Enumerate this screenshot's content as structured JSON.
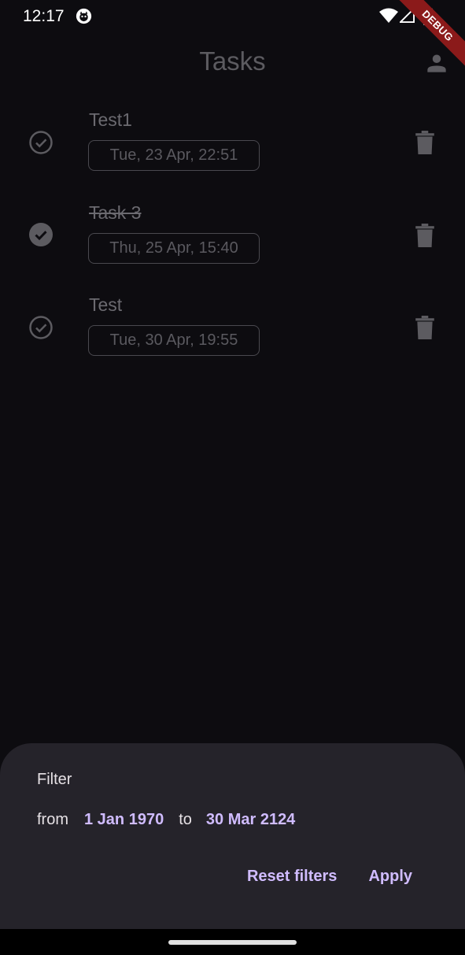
{
  "status_bar": {
    "time": "12:17",
    "debug_label": "DEBUG"
  },
  "app_bar": {
    "title": "Tasks"
  },
  "tasks": [
    {
      "title": "Test1",
      "date": "Tue, 23 Apr, 22:51",
      "completed": false
    },
    {
      "title": "Task 3",
      "date": "Thu, 25 Apr, 15:40",
      "completed": true
    },
    {
      "title": "Test",
      "date": "Tue, 30 Apr, 19:55",
      "completed": false
    }
  ],
  "filter_sheet": {
    "title": "Filter",
    "from_label": "from",
    "from_date": "1 Jan 1970",
    "to_label": "to",
    "to_date": "30 Mar 2124",
    "reset_label": "Reset filters",
    "apply_label": "Apply"
  },
  "colors": {
    "background": "#0d0c10",
    "sheet": "#25232a",
    "accent": "#d0bcff",
    "debug_banner": "#8b1a1a"
  }
}
